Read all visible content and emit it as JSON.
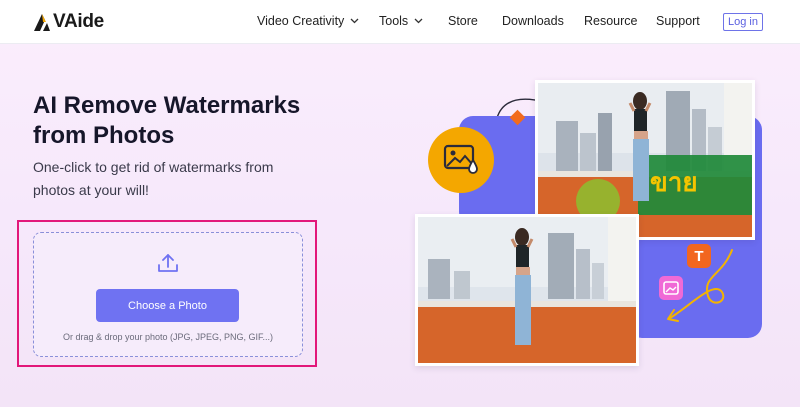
{
  "brand": {
    "name": "VAide"
  },
  "nav": {
    "items": [
      {
        "label": "Video Creativity",
        "has_dropdown": true
      },
      {
        "label": "Tools",
        "has_dropdown": true
      },
      {
        "label": "Store",
        "has_dropdown": false
      },
      {
        "label": "Downloads",
        "has_dropdown": false
      },
      {
        "label": "Resource",
        "has_dropdown": false
      },
      {
        "label": "Support",
        "has_dropdown": false
      }
    ],
    "login_label": "Log in"
  },
  "hero": {
    "title_line1": "AI Remove Watermarks",
    "title_line2": "from Photos",
    "subtitle_line1": "One-click to get rid of watermarks from",
    "subtitle_line2": "photos at your will!"
  },
  "upload": {
    "button_label": "Choose a Photo",
    "hint": "Or drag & drop your photo (JPG, JPEG, PNG, GIF...)",
    "icon": "upload-icon"
  },
  "illustration": {
    "watermark_text": "ขาย",
    "icons": [
      "image-drop-icon",
      "text-tool-icon",
      "image-tool-icon",
      "curved-arrow-icon"
    ]
  },
  "colors": {
    "accent": "#6f72f2",
    "highlight": "#e2177a",
    "purple_panel": "#6a6cf0",
    "orange": "#f2a500",
    "text_dark": "#16162a"
  }
}
